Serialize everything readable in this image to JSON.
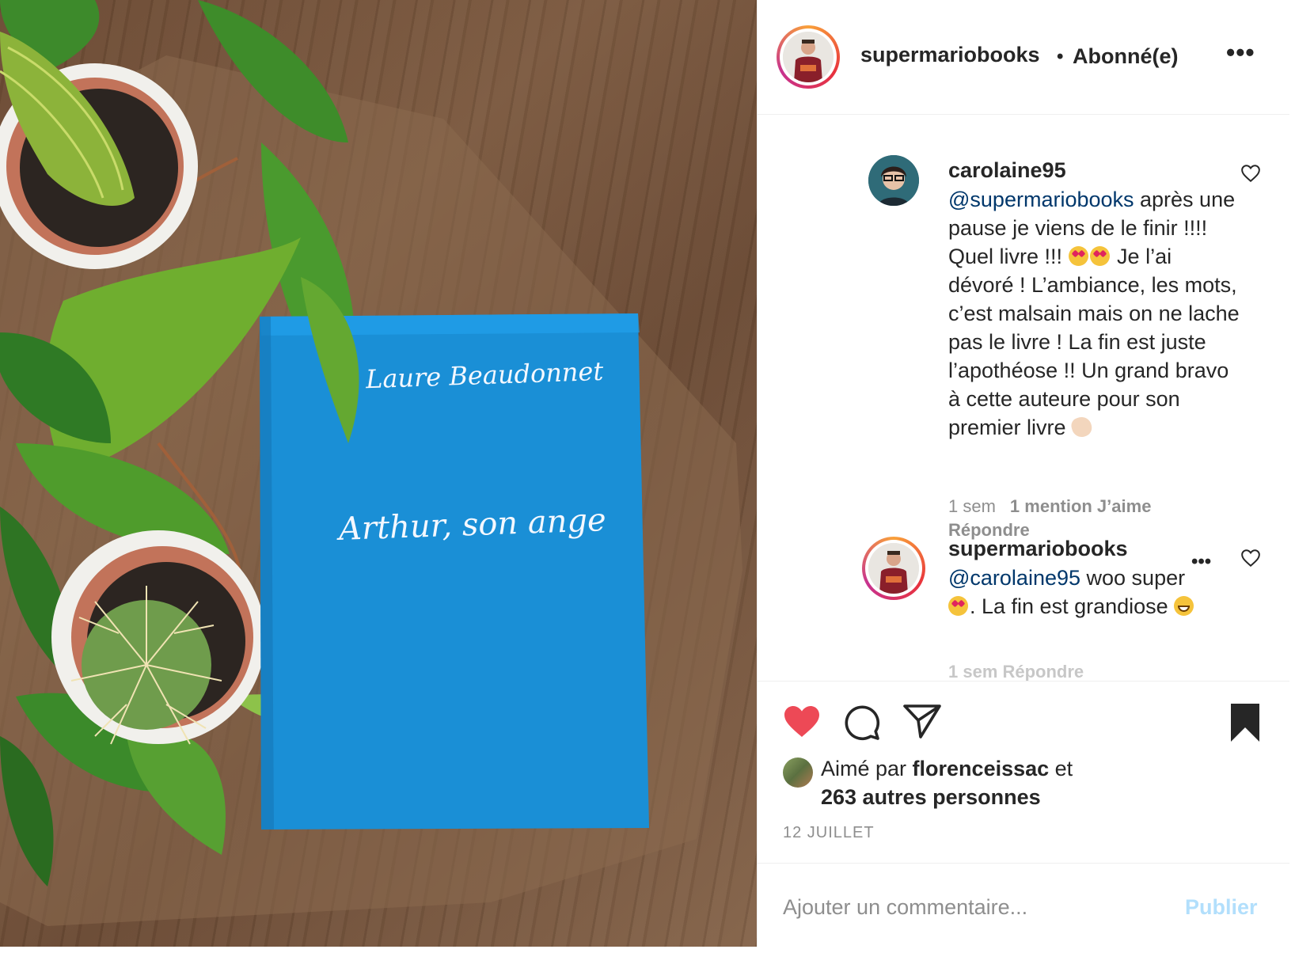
{
  "post": {
    "photo": {
      "book_author": "Laure Beaudonnet",
      "book_title": "Arthur, son ange"
    },
    "header": {
      "username": "supermariobooks",
      "separator": "•",
      "follow_status": "Abonné(e)",
      "more": "•••"
    },
    "comments": [
      {
        "username": "carolaine95",
        "mention": "@supermariobooks",
        "text_part1": " après une pause je viens de le finir !!!! Quel livre !!! ",
        "text_part2": " Je l’ai dévoré ! L’ambiance, les mots, c’est malsain mais on ne lache pas le livre ! La fin est juste l’apothéose !! Un grand bravo à cette auteure pour son premier livre ",
        "emojis": [
          "heart-eyes",
          "heart-eyes",
          "clap"
        ],
        "time": "1 sem",
        "likes": "1 mention J’aime",
        "reply": "Répondre"
      },
      {
        "username": "supermariobooks",
        "mention": "@carolaine95",
        "text_part1": " woo super ",
        "text_part2": ". La fin est grandiose ",
        "emojis": [
          "heart-eyes",
          "grin"
        ],
        "more": "•••",
        "meta": "1 sem   Répondre"
      }
    ],
    "likes": {
      "prefix": "Aimé par ",
      "user": "florenceissac",
      "middle": " et",
      "others": "263 autres personnes"
    },
    "date": "12 JUILLET",
    "add_comment": {
      "placeholder": "Ajouter un commentaire...",
      "publish": "Publier"
    },
    "colors": {
      "like_red": "#ed4956",
      "mention_blue": "#00376b",
      "publish_disabled": "#b2dffc",
      "book_blue": "#1a8fd6"
    }
  }
}
